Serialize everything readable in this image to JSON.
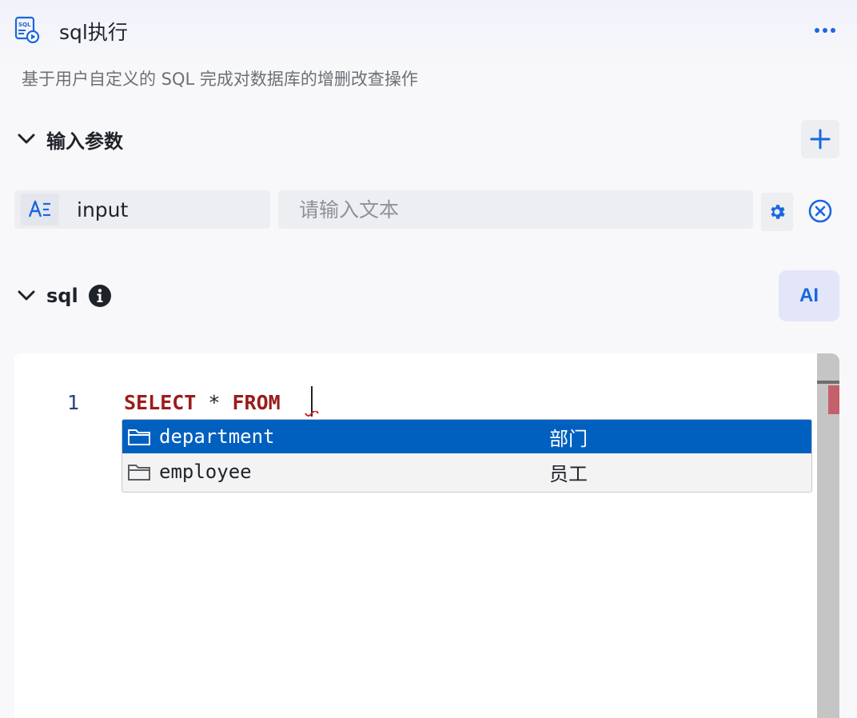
{
  "header": {
    "app_icon": "sql-icon",
    "title": "sql执行",
    "more_icon": "more-horizontal-icon"
  },
  "description": "基于用户自定义的 SQL 完成对数据库的增删改查操作",
  "input_params": {
    "title": "输入参数",
    "add_icon": "plus-icon",
    "rows": [
      {
        "type_icon": "text-type-icon",
        "name": "input",
        "value": "",
        "placeholder": "请输入文本"
      }
    ]
  },
  "sql_section": {
    "title": "sql",
    "info_icon": "info-icon",
    "ai_label": "AI"
  },
  "editor": {
    "line_numbers": [
      "1"
    ],
    "code_tokens": [
      {
        "text": "SELECT",
        "kind": "keyword"
      },
      {
        "text": " * ",
        "kind": "operator"
      },
      {
        "text": "FROM",
        "kind": "keyword"
      }
    ],
    "suggestions": [
      {
        "icon": "folder-icon",
        "label": "department",
        "detail": "部门",
        "selected": true
      },
      {
        "icon": "folder-icon",
        "label": "employee",
        "detail": "员工",
        "selected": false
      }
    ]
  },
  "colors": {
    "accent": "#1a66e0",
    "keyword": "#9b1c1c",
    "selection": "#0060c0"
  }
}
